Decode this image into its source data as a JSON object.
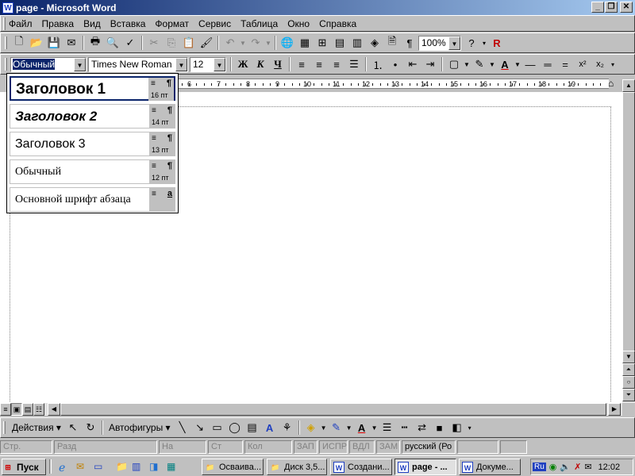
{
  "window": {
    "title": "page - Microsoft Word",
    "app_icon": "word-icon"
  },
  "menu": [
    "Файл",
    "Правка",
    "Вид",
    "Вставка",
    "Формат",
    "Сервис",
    "Таблица",
    "Окно",
    "Справка"
  ],
  "standard_toolbar": {
    "zoom": "100%"
  },
  "formatting_toolbar": {
    "style": "Обычный",
    "font": "Times New Roman",
    "size": "12",
    "bold": "Ж",
    "italic": "К",
    "underline": "Ч",
    "superscript": "x²",
    "subscript": "x₂"
  },
  "ruler": {
    "labels": [
      "6",
      "7",
      "8",
      "9",
      "10",
      "11",
      "12",
      "13",
      "14",
      "15",
      "16",
      "17",
      "18",
      "19"
    ]
  },
  "style_dropdown": [
    {
      "name": "Заголовок 1",
      "size": "16 пт",
      "para_mark": "¶"
    },
    {
      "name": "Заголовок 2",
      "size": "14 пт",
      "para_mark": "¶"
    },
    {
      "name": "Заголовок 3",
      "size": "13 пт",
      "para_mark": "¶"
    },
    {
      "name": "Обычный",
      "size": "12 пт",
      "para_mark": "¶"
    },
    {
      "name": "Основной шрифт абзаца",
      "size": "",
      "para_mark": "a"
    }
  ],
  "drawing_toolbar": {
    "actions": "Действия",
    "autoshapes": "Автофигуры"
  },
  "status_bar": {
    "page": "Стр.",
    "section": "Разд",
    "at": "На",
    "line": "Ст",
    "col": "Кол",
    "rec": "ЗАП",
    "trk": "ИСПР",
    "ext": "ВДЛ",
    "ovr": "ЗАМ",
    "language": "русский (Ро"
  },
  "taskbar": {
    "start": "Пуск",
    "tasks": [
      {
        "label": "Осваива...",
        "icon": "folder-icon"
      },
      {
        "label": "Диск 3,5...",
        "icon": "folder-icon"
      },
      {
        "label": "Создани...",
        "icon": "word-doc-icon"
      },
      {
        "label": "page - ...",
        "icon": "word-doc-icon",
        "active": true
      },
      {
        "label": "Докуме...",
        "icon": "word-doc-icon"
      }
    ],
    "tray": {
      "lang": "Ru",
      "time": "12:02"
    }
  }
}
